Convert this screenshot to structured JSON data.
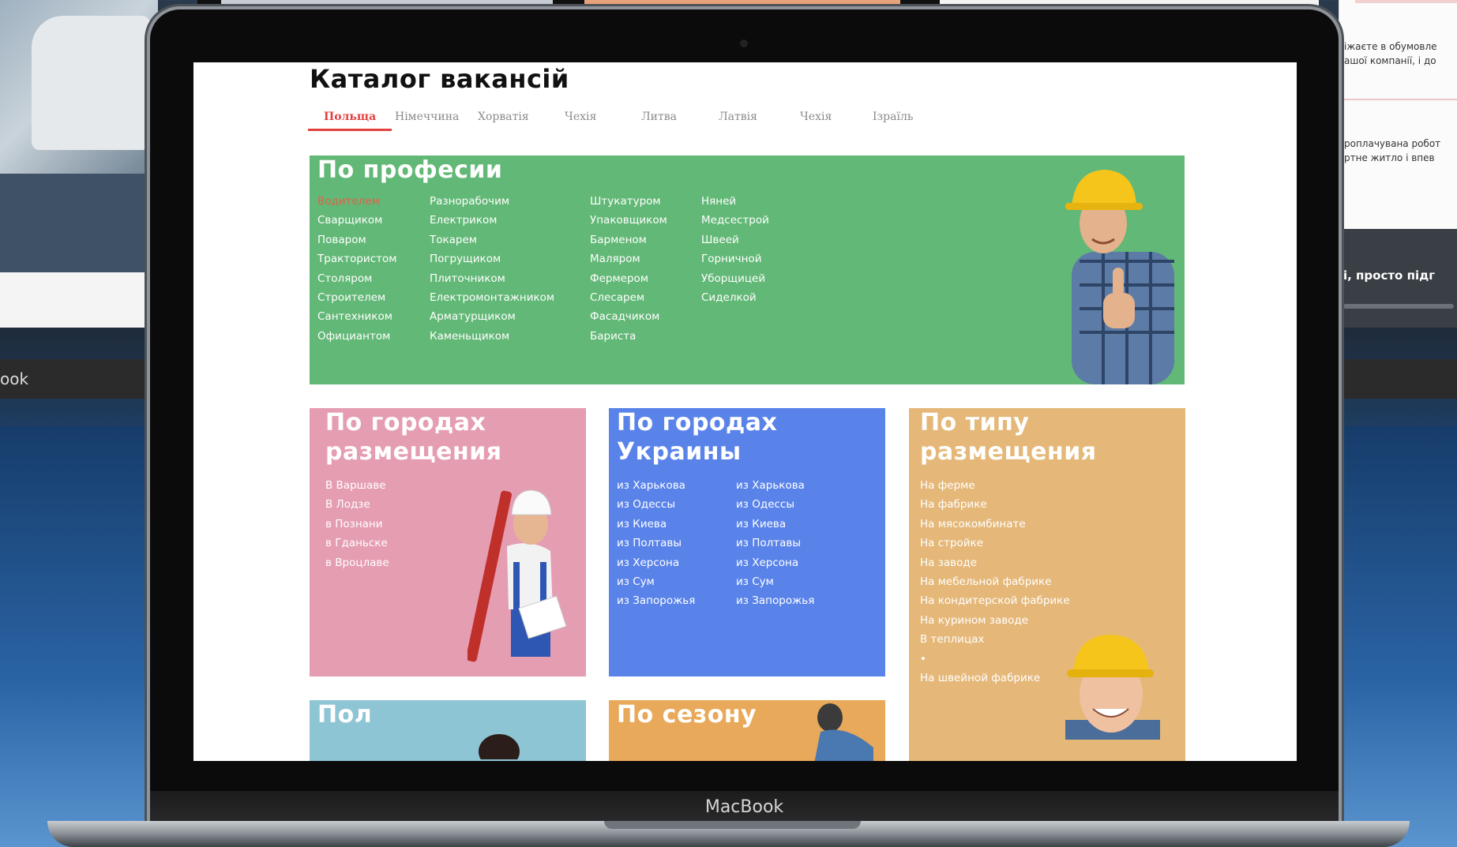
{
  "background": {
    "left_bar_text": "ook",
    "right_doc_lines": [
      "іжаєте в обумовле",
      "ашої компанії, і до",
      "роплачувана робот",
      "ртне житло і впев"
    ],
    "right_dark_text": "і, просто підг"
  },
  "laptop": {
    "brand": "MacBook"
  },
  "page": {
    "title": "Каталог вакансій",
    "tabs": [
      "Польща",
      "Німеччина",
      "Хорватія",
      "Чехія",
      "Литва",
      "Латвія",
      "Чехія",
      "Ізраїль"
    ],
    "active_tab": 0
  },
  "profession": {
    "title": "По професии",
    "columns": [
      [
        "Водителем",
        "Сварщиком",
        "Поваром",
        "Трактористом",
        "Столяром",
        "Строителем",
        "Сантехником",
        "Официантом"
      ],
      [
        "Разнорабочим",
        "Електриком",
        "Токарем",
        "Погрущиком",
        "Плиточником",
        "Електромонтажником",
        "Арматурщиком",
        "Каменьщиком"
      ],
      [
        "Штукатуром",
        "Упаковщиком",
        "Барменом",
        "Маляром",
        "Фермером",
        "Слесарем",
        "Фасадчиком",
        "Бариста"
      ],
      [
        "Няней",
        "Медсестрой",
        "Швеей",
        "Горничной",
        "Уборщицей",
        "Сиделкой"
      ]
    ]
  },
  "cities": {
    "title_line1": "По городах",
    "title_line2": "размещения",
    "items": [
      "В Варшаве",
      "В Лодзе",
      "в Познани",
      "в Гданьске",
      "в Вроцлаве"
    ]
  },
  "ukraine": {
    "title_line1": "По городах",
    "title_line2": "Украины",
    "columns": [
      [
        "из Харькова",
        "из Одессы",
        "из Киева",
        "из Полтавы",
        "из Херсона",
        "из Сум",
        "из Запорожья"
      ],
      [
        "из Харькова",
        "из Одессы",
        "из Киева",
        "из Полтавы",
        "из Херсона",
        "из Сум",
        "из Запорожья"
      ]
    ]
  },
  "placement": {
    "title_line1": "По типу",
    "title_line2": "размещения",
    "items": [
      "На ферме",
      "На фабрике",
      "На мясокомбинате",
      "На стройке",
      "На заводе",
      "На мебельной фабрике",
      "На кондитерской фабрике",
      "На курином заводе",
      "В теплицах",
      "•",
      "На швейной фабрике"
    ]
  },
  "gender": {
    "title": "Пол"
  },
  "season": {
    "title": "По сезону"
  },
  "colors": {
    "profession": "#62b876",
    "cities": "#e59db2",
    "ukraine": "#5a83ea",
    "placement": "#e5b879",
    "gender": "#8ec5d4",
    "season": "#e8a95a",
    "active_tab": "#e2413f"
  }
}
